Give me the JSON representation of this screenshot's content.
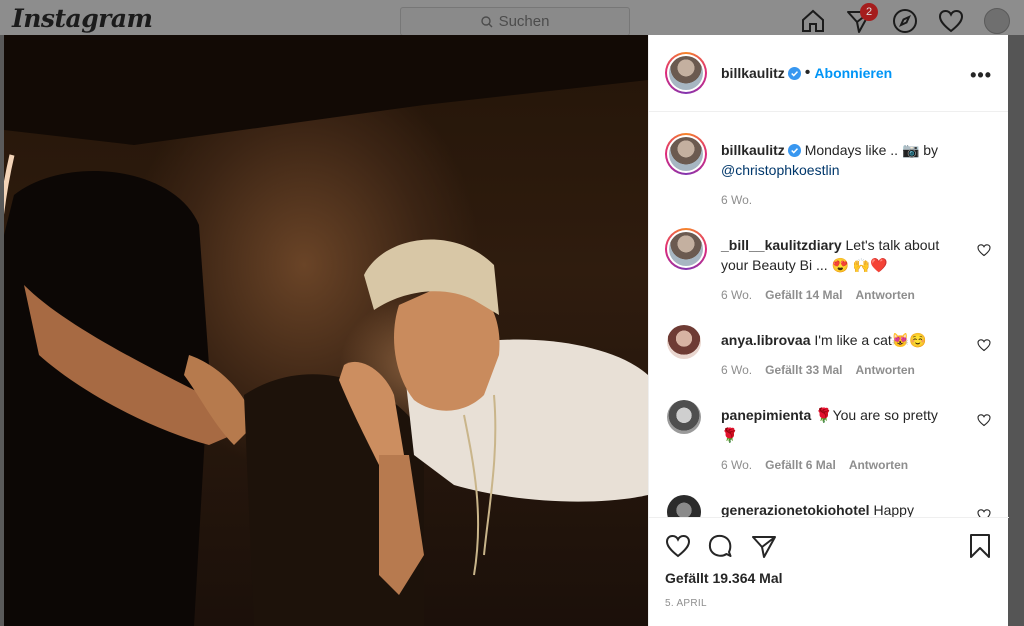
{
  "header": {
    "logo": "Instagram",
    "search_placeholder": "Suchen",
    "notification_count": "2"
  },
  "post": {
    "author": "billkaulitz",
    "separator": "•",
    "follow_label": "Abonnieren",
    "more_label": "•••",
    "caption": {
      "username": "billkaulitz",
      "text": "Mondays like .. 📷 by",
      "mention": "@christophkoestlin",
      "time": "6 Wo."
    },
    "comments": [
      {
        "username": "_bill__kaulitzdiary",
        "text": "Let's talk about your Beauty Bi ... 😍 🙌❤️",
        "time": "6 Wo.",
        "likes": "Gefällt 14 Mal",
        "reply": "Antworten"
      },
      {
        "username": "anya.librovaa",
        "text": "I'm like a cat😻☺️",
        "time": "6 Wo.",
        "likes": "Gefällt 33 Mal",
        "reply": "Antworten"
      },
      {
        "username": "panepimienta",
        "text": "🌹You are so pretty 🌹",
        "time": "6 Wo.",
        "likes": "Gefällt 6 Mal",
        "reply": "Antworten"
      },
      {
        "username": "generazionetokiohotel",
        "text": "Happy"
      }
    ],
    "likes_total": "Gefällt 19.364 Mal",
    "date": "5. APRIL"
  },
  "colors": {
    "accent": "#0095f6",
    "mention": "#00376b",
    "muted": "#8e8e8e",
    "heart": "#ed4956"
  }
}
